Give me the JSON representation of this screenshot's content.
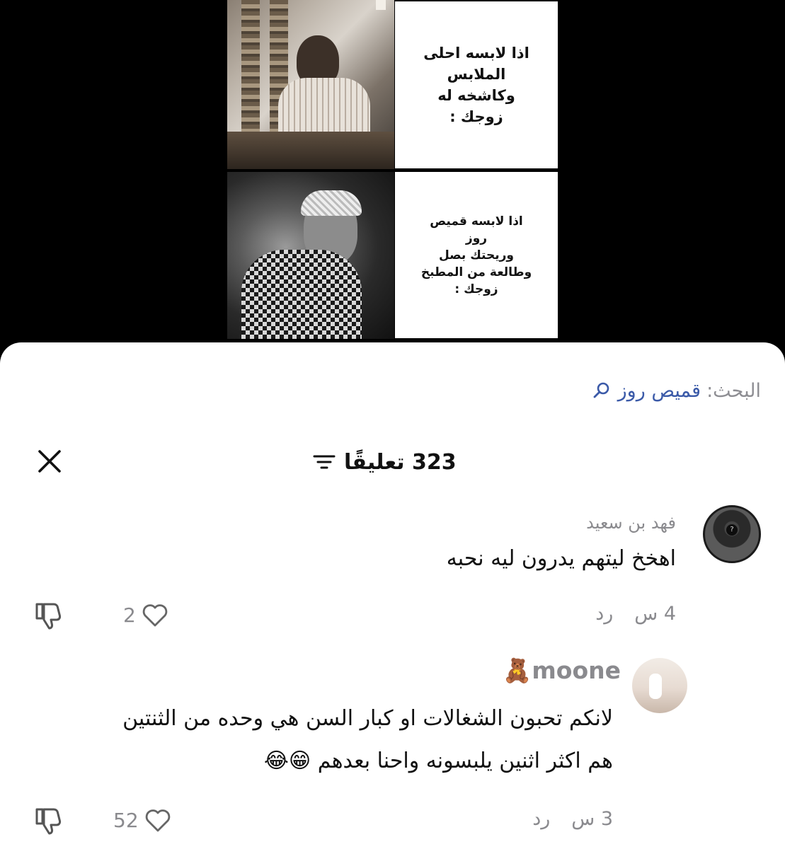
{
  "meme": {
    "panel1_text": "اذا لابسه احلى\nالملابس\nوكاشخه له\nزوجك :",
    "panel2_text": "اذا لابسه قميص\nروز\nوريحتك بصل\nوطالعة من المطبخ\nزوجك :"
  },
  "search": {
    "label": "البحث:",
    "term": "قميص روز",
    "icon": "search-icon"
  },
  "comments_header": {
    "count_label": "323 تعليقًا",
    "filter_icon": "filter-icon",
    "close_icon": "close-icon"
  },
  "comments": [
    {
      "username": "فهد بن سعيد",
      "text": "اهخخ ليتهم يدرون ليه نحبه",
      "time": "4 س",
      "reply_label": "رد",
      "likes": "2"
    },
    {
      "username": "moone🧸",
      "text": "لانكم تحبون الشغالات او كبار السن هي وحده من الثنتين\nهم اكثر اثنين يلبسونه واحنا بعدهم 😁😂",
      "time": "3 س",
      "reply_label": "رد",
      "likes": "52"
    }
  ],
  "colors": {
    "search_term": "#3b5aa8",
    "muted": "#8a8a8e",
    "background_top": "#000000"
  }
}
